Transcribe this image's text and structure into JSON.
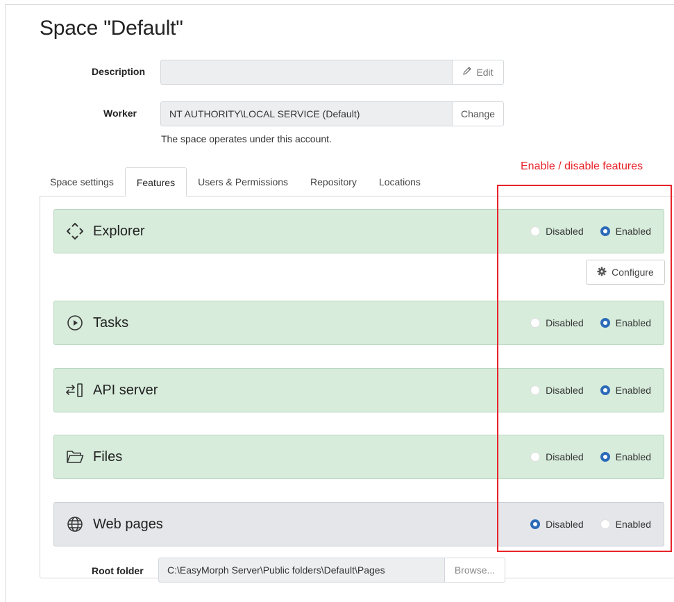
{
  "page": {
    "title": "Space \"Default\""
  },
  "description": {
    "label": "Description",
    "value": "",
    "button_label": "Edit",
    "button_icon": "pencil-icon"
  },
  "worker": {
    "label": "Worker",
    "value": "NT AUTHORITY\\LOCAL SERVICE (Default)",
    "button_label": "Change",
    "help": "The space operates under this account."
  },
  "annotation": {
    "text": "Enable / disable features",
    "color": "#e8232a"
  },
  "tabs": [
    {
      "label": "Space settings",
      "active": false
    },
    {
      "label": "Features",
      "active": true
    },
    {
      "label": "Users & Permissions",
      "active": false
    },
    {
      "label": "Repository",
      "active": false
    },
    {
      "label": "Locations",
      "active": false
    }
  ],
  "radio_labels": {
    "disabled": "Disabled",
    "enabled": "Enabled"
  },
  "features": [
    {
      "name": "Explorer",
      "icon": "explorer-arrows-icon",
      "state": "Enabled"
    },
    {
      "name": "Tasks",
      "icon": "play-circle-icon",
      "state": "Enabled"
    },
    {
      "name": "API server",
      "icon": "api-exchange-icon",
      "state": "Enabled"
    },
    {
      "name": "Files",
      "icon": "folder-open-icon",
      "state": "Enabled"
    },
    {
      "name": "Web pages",
      "icon": "globe-icon",
      "state": "Disabled"
    }
  ],
  "configure": {
    "label": "Configure",
    "icon": "gear-icon"
  },
  "root_folder": {
    "label": "Root folder",
    "value": "C:\\EasyMorph Server\\Public folders\\Default\\Pages",
    "button_label": "Browse..."
  },
  "colors": {
    "enabled_panel": "#d7ecdb",
    "disabled_panel": "#e4e6ea",
    "radio_accent": "#2b6ab8"
  }
}
